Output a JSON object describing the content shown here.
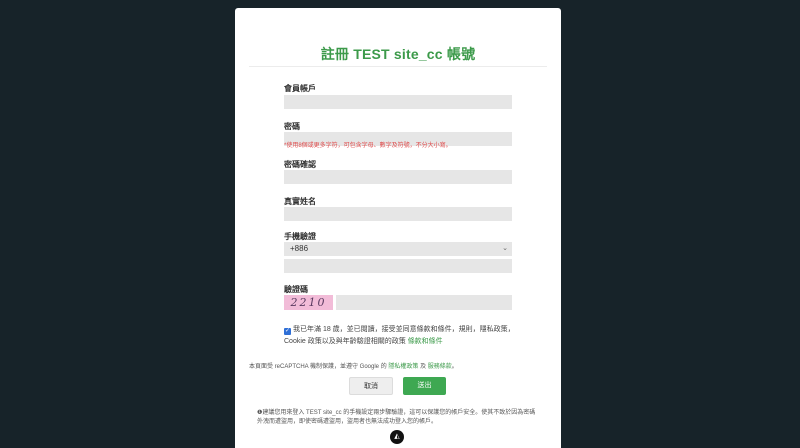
{
  "form": {
    "title": "註冊 TEST site_cc 帳號",
    "account_label": "會員帳戶",
    "password_label": "密碼",
    "password_hint": "*使用8個或更多字符，可包含字母、數字及符號，不分大小寫。",
    "confirm_label": "密碼確認",
    "realname_label": "真實姓名",
    "phone_label": "手機驗證",
    "phone_country": "+886",
    "captcha_label": "驗證碼",
    "captcha_text": "2210",
    "agree_text": "我已年滿 18 歲，並已閱讀，接受並同意條款和條件，規則，隱私政策，Cookie 政策以及與年齡驗證相關的政策",
    "agree_link": "條款和條件",
    "recaptcha_prefix": "本頁面受 reCAPTCHA 機制保護，並遵守 Google 的",
    "recaptcha_privacy": "隱私權政策",
    "recaptcha_and": "及",
    "recaptcha_terms": "服務條款",
    "recaptcha_end": "。",
    "cancel_label": "取消",
    "submit_label": "送出",
    "notice": "❶建議您用來登入 TEST site_cc 的手機設定兩步驟驗證，這可以保護您的帳戶安全。使其不致於因為密碼外洩而遭盜用，即使密碼遭盜用，盜用者也無法成功登入您的帳戶。"
  },
  "colors": {
    "accent": "#3ea852",
    "background": "#172329",
    "hint": "#e04b4b"
  },
  "icons": {
    "chevron": "chevron-down-icon",
    "checkbox": "checkmark-icon",
    "brand": "brand-logo-icon"
  }
}
